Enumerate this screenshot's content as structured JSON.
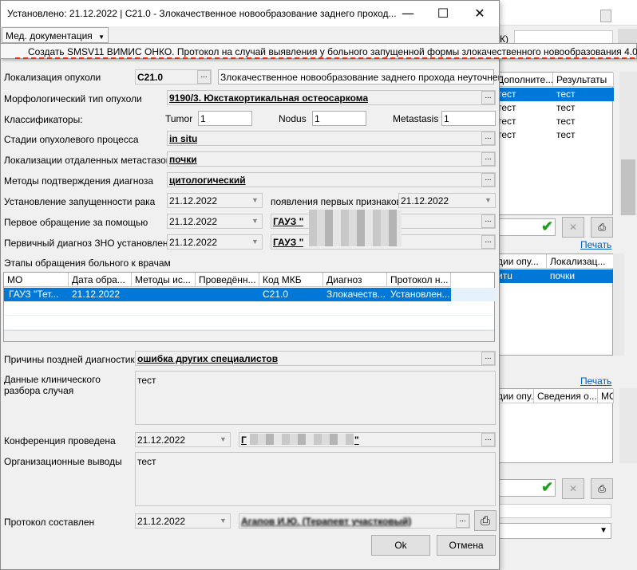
{
  "window": {
    "title": "Установлено: 21.12.2022 | C21.0 - Злокачественное новообразование заднего проход...",
    "minimize_icon": "—",
    "maximize_icon": "☐",
    "close_icon": "✕"
  },
  "menu": {
    "med_docs": "Мед. документация",
    "dropdown_item": "Создать SMSV11 ВИМИС ОНКО. Протокол на случай выявления у больного запущенной формы злокачественного новообразования 4.0"
  },
  "form": {
    "localization_label": "Локализация опухоли",
    "localization_code": "C21.0",
    "localization_text": "Злокачественное новообразование заднего прохода неуточненной",
    "morph_label": "Морфологический тип опухоли",
    "morph_value": "9190/3. Юкстакортикальная остеосаркома",
    "classifiers_label": "Классификаторы:",
    "tumor_label": "Tumor",
    "tumor_value": "1",
    "nodus_label": "Nodus",
    "nodus_value": "1",
    "metastasis_label": "Metastasis",
    "metastasis_value": "1",
    "stages_label": "Стадии опухолевого процесса",
    "stages_value": "in situ",
    "metastases_loc_label": "Локализации отдаленных метастазов",
    "metastases_loc_value": "почки",
    "methods_label": "Методы подтверждения диагноза",
    "methods_value": "цитологический",
    "neglect_label": "Установление запущенности рака",
    "neglect_date": "21.12.2022",
    "first_signs_label": "появления первых признаков",
    "first_signs_date": "21.12.2022",
    "first_visit_label": "Первое обращение за помощью",
    "first_visit_date": "21.12.2022",
    "first_visit_org": "ГАУЗ \"",
    "primary_diag_label": "Первичный диагноз ЗНО установлен",
    "primary_diag_date": "21.12.2022",
    "primary_diag_org": "ГАУЗ \"",
    "stages_table_label": "Этапы обращения больного к врачам",
    "late_reasons_label": "Причины поздней диагностики",
    "late_reasons_value": "ошибка других специалистов",
    "clinical_label_1": "Данные клинического",
    "clinical_label_2": "разбора случая",
    "clinical_value": "тест",
    "conference_label": "Конференция проведена",
    "conference_date": "21.12.2022",
    "conference_org": "Г",
    "conference_org_tail": "\"",
    "conclusions_label": "Организационные выводы",
    "conclusions_value": "тест",
    "protocol_label": "Протокол составлен",
    "protocol_date": "21.12.2022",
    "protocol_author": "Агапов И.Ю. (Терапевт участковый)"
  },
  "stages_table": {
    "columns": [
      "МО",
      "Дата обра...",
      "Методы ис...",
      "Проведённ...",
      "Код МКБ",
      "Диагноз",
      "Протокол н..."
    ],
    "rows": [
      [
        "ГАУЗ \"Тет...",
        "21.12.2022",
        "",
        "",
        "C21.0",
        "Злокачеств...",
        "Установлен..."
      ]
    ]
  },
  "buttons": {
    "ok": "Ok",
    "cancel": "Отмена",
    "ellipsis": "...",
    "dropdown_arrow": "▼"
  },
  "right_pane": {
    "table1_headers": [
      "Дополните...",
      "Результаты"
    ],
    "table1_rows": [
      [
        "тест",
        "тест"
      ],
      [
        "тест",
        "тест"
      ],
      [
        "тест",
        "тест"
      ],
      [
        "тест",
        "тест"
      ]
    ],
    "print_link_1": "Печать",
    "table2_headers": [
      "дии опу...",
      "Локализац..."
    ],
    "table2_row": [
      "итu",
      "почки"
    ],
    "print_link_2": "Печать",
    "table3_headers": [
      "дии опу...",
      "Сведения о...",
      "МО"
    ],
    "partial_k": "К)"
  },
  "colors": {
    "selection": "#0078d7",
    "link": "#0060c0",
    "dashed_underline": "#e03020",
    "check": "#1f9e1f"
  }
}
